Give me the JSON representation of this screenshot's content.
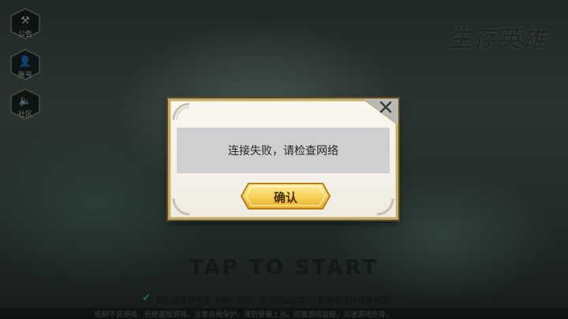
{
  "scene": {
    "logo_text": "生存英雄",
    "tap_text": "TAP TO START",
    "agreement_text": "我已阅读并同意《用户协议》和《隐私政策》，并承诺遵守相关规定",
    "footer_text": "抵制不良游戏，拒绝盗版游戏。注意自我保护，谨防受骗上当。适度游戏益脑，沉迷游戏伤身。",
    "side_buttons": [
      {
        "label": "公告",
        "icon": "hammer-icon"
      },
      {
        "label": "账号",
        "icon": "user-icon"
      },
      {
        "label": "社区",
        "icon": "speaker-icon"
      }
    ]
  },
  "dialog": {
    "message": "连接失败，请检查网络",
    "confirm_label": "确认"
  },
  "colors": {
    "dialog_border": "#c2ab6c",
    "button_gold": "#f6d35a",
    "check_green": "#3fc84a"
  }
}
